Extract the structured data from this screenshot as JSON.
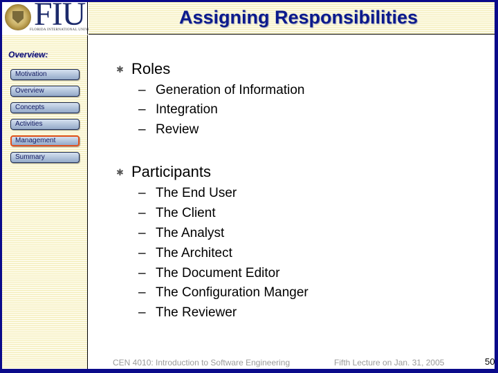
{
  "header": {
    "logo_text": "FIU",
    "logo_subtitle": "FLORIDA INTERNATIONAL UNIVERSITY",
    "title": "Assigning Responsibilities"
  },
  "sidebar": {
    "heading": "Overview:",
    "items": [
      {
        "label": "Motivation",
        "active": false
      },
      {
        "label": "Overview",
        "active": false
      },
      {
        "label": "Concepts",
        "active": false
      },
      {
        "label": "Activities",
        "active": false
      },
      {
        "label": "Management",
        "active": true
      },
      {
        "label": "Summary",
        "active": false
      }
    ],
    "active_color": "#e0501c"
  },
  "content": {
    "sections": [
      {
        "heading": "Roles",
        "items": [
          "Generation of Information",
          "Integration",
          "Review"
        ]
      },
      {
        "heading": "Participants",
        "items": [
          "The End User",
          "The Client",
          "The Analyst",
          "The Architect",
          "The Document Editor",
          "The Configuration Manger",
          "The Reviewer"
        ]
      }
    ],
    "bullet_symbol": "✱",
    "dash_symbol": "–"
  },
  "footer": {
    "course": "CEN 4010: Introduction to Software Engineering",
    "lecture": "Fifth Lecture on Jan. 31, 2005",
    "page_number": "50"
  },
  "colors": {
    "frame": "#0a0a8a",
    "title": "#0c1a8c",
    "stripe_bg": "#fbf8dc"
  }
}
